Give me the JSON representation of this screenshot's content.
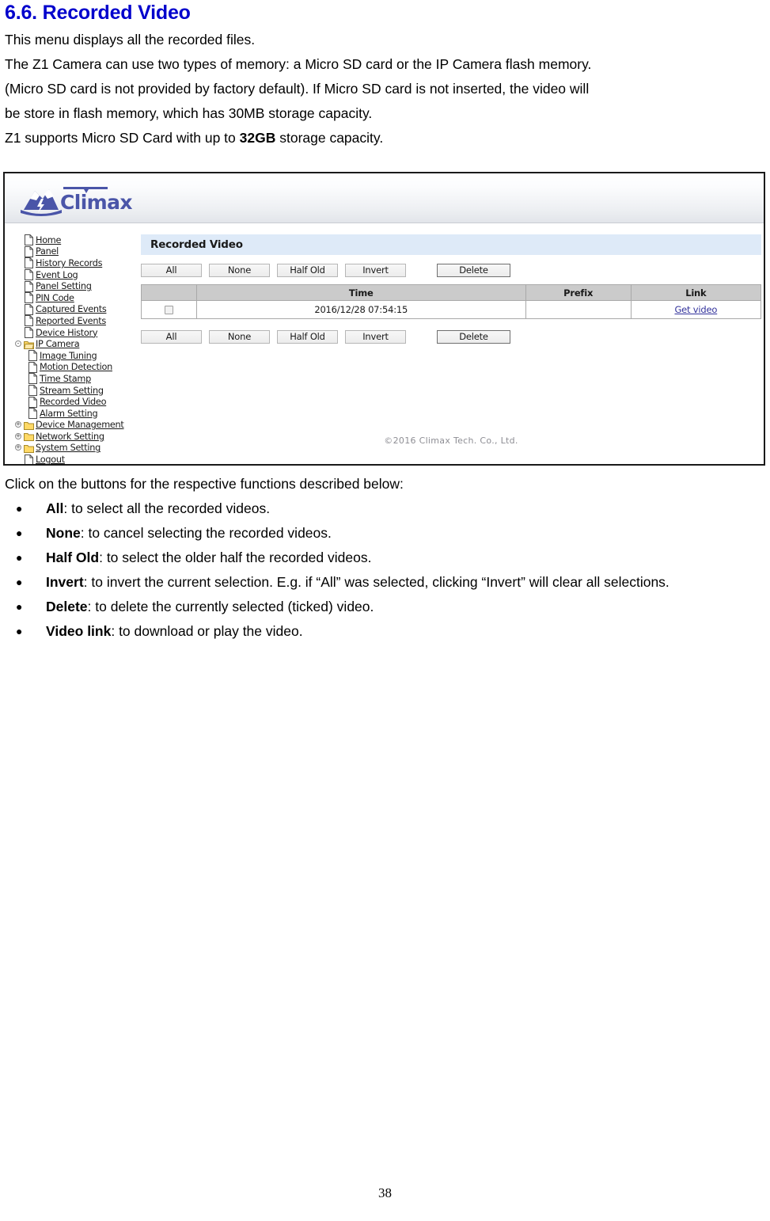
{
  "document": {
    "section_title": "6.6. Recorded Video",
    "paragraphs": [
      "This menu displays all the recorded files.",
      "The Z1 Camera can use two types of memory: a Micro SD card or the IP Camera flash memory.",
      "(Micro SD card is not provided by factory default). If Micro SD card is not inserted, the video will",
      "be store in flash memory, which has 30MB storage capacity."
    ],
    "capacity_line": {
      "prefix": "Z1 supports Micro SD Card with up to ",
      "bold": "32GB",
      "suffix": " storage capacity."
    },
    "intro_after": "Click on the buttons for the respective functions described below:",
    "bullets": [
      {
        "bullet": "●",
        "term": "All",
        "rest": ": to select all the recorded videos."
      },
      {
        "bullet": "●",
        "term": "None",
        "rest": ": to cancel selecting the recorded videos."
      },
      {
        "bullet": "●",
        "term": "Half Old",
        "rest": ": to select the older half the recorded videos."
      },
      {
        "bullet": "●",
        "term": "Invert",
        "rest": ": to invert the current selection. E.g. if “All” was selected, clicking “Invert” will clear all selections."
      },
      {
        "bullet": "●",
        "term": "Delete",
        "rest": ": to delete the currently selected (ticked) video."
      },
      {
        "bullet": "●",
        "term": "Video link",
        "rest": ": to download or play the video."
      }
    ],
    "page_number": "38"
  },
  "screenshot": {
    "brand": {
      "name": "Climax",
      "logo_icon": "climax-mountain-logo",
      "color": "#4a55a8"
    },
    "sidebar": {
      "items": [
        {
          "label": "Home",
          "icon": "page-icon",
          "level": 0,
          "toggle": ""
        },
        {
          "label": "Panel",
          "icon": "page-icon",
          "level": 0,
          "toggle": ""
        },
        {
          "label": "History Records",
          "icon": "page-icon",
          "level": 0,
          "toggle": ""
        },
        {
          "label": "Event Log",
          "icon": "page-icon",
          "level": 0,
          "toggle": ""
        },
        {
          "label": "Panel Setting",
          "icon": "page-icon",
          "level": 0,
          "toggle": ""
        },
        {
          "label": "PIN Code",
          "icon": "page-icon",
          "level": 0,
          "toggle": ""
        },
        {
          "label": "Captured Events",
          "icon": "page-icon",
          "level": 0,
          "toggle": ""
        },
        {
          "label": "Reported Events",
          "icon": "page-icon",
          "level": 0,
          "toggle": ""
        },
        {
          "label": "Device History",
          "icon": "page-icon",
          "level": 0,
          "toggle": ""
        },
        {
          "label": "IP Camera",
          "icon": "folder-open-icon",
          "level": 0,
          "toggle": "-"
        },
        {
          "label": "Image Tuning",
          "icon": "page-icon",
          "level": 1,
          "toggle": ""
        },
        {
          "label": "Motion Detection",
          "icon": "page-icon",
          "level": 1,
          "toggle": ""
        },
        {
          "label": "Time Stamp",
          "icon": "page-icon",
          "level": 1,
          "toggle": ""
        },
        {
          "label": "Stream Setting",
          "icon": "page-icon",
          "level": 1,
          "toggle": ""
        },
        {
          "label": "Recorded Video",
          "icon": "page-icon",
          "level": 1,
          "toggle": ""
        },
        {
          "label": "Alarm Setting",
          "icon": "page-icon",
          "level": 1,
          "toggle": ""
        },
        {
          "label": "Device Management",
          "icon": "folder-icon",
          "level": 0,
          "toggle": "+"
        },
        {
          "label": "Network Setting",
          "icon": "folder-icon",
          "level": 0,
          "toggle": "+"
        },
        {
          "label": "System Setting",
          "icon": "folder-icon",
          "level": 0,
          "toggle": "+"
        },
        {
          "label": "Logout",
          "icon": "page-icon",
          "level": 0,
          "toggle": ""
        }
      ]
    },
    "panel": {
      "title": "Recorded Video",
      "title_bg": "#deeaf8",
      "buttons": [
        {
          "label": "All",
          "primary": false
        },
        {
          "label": "None",
          "primary": false
        },
        {
          "label": "Half Old",
          "primary": false
        },
        {
          "label": "Invert",
          "primary": false
        },
        {
          "label": "Delete",
          "primary": true
        }
      ],
      "table": {
        "columns": [
          "",
          "Time",
          "Prefix",
          "Link"
        ],
        "rows": [
          {
            "checked": false,
            "time": "2016/12/28 07:54:15",
            "prefix": "",
            "link": "Get video"
          }
        ]
      }
    },
    "footer": {
      "copyright": "©2016 Climax Tech. Co., Ltd."
    }
  }
}
